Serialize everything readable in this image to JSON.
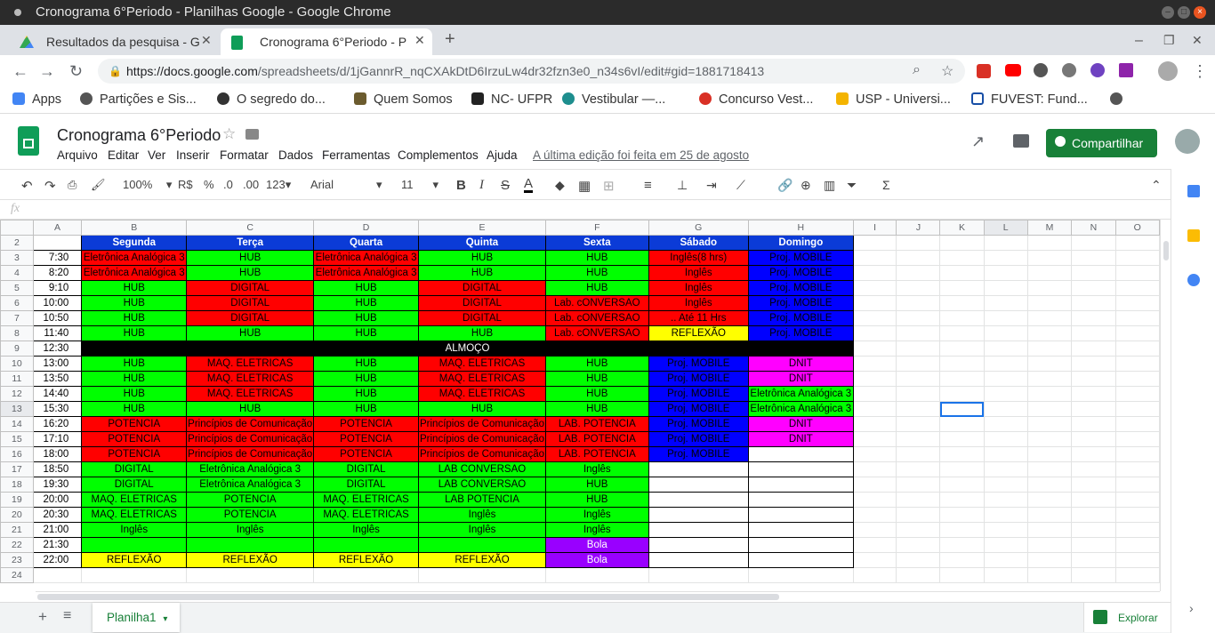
{
  "window": {
    "title": "Cronograma 6°Periodo - Planilhas Google - Google Chrome"
  },
  "tabs": [
    {
      "label": "Resultados da pesquisa - G"
    },
    {
      "label": "Cronograma 6°Periodo - P"
    }
  ],
  "address": {
    "host": "https://docs.google.com",
    "path": "/spreadsheets/d/1jGannrR_nqCXAkDtD6IrzuLw4dr32fzn3e0_n34s6vI/edit#gid=1881718413"
  },
  "bookmarks": [
    {
      "label": "Apps",
      "color": "#4285f4"
    },
    {
      "label": "Partições e Sis...",
      "color": "#555555"
    },
    {
      "label": "O segredo do...",
      "color": "#333333"
    },
    {
      "label": "Quem Somos",
      "color": "#6b5b2e"
    },
    {
      "label": "NC- UFPR",
      "color": "#222222"
    },
    {
      "label": "Vestibular —...",
      "color": "#1e8e8e"
    },
    {
      "label": "Concurso Vest...",
      "color": "#d93025"
    },
    {
      "label": "USP - Universi...",
      "color": "#f4b400"
    },
    {
      "label": "FUVEST: Fund...",
      "color": "#174ea6"
    }
  ],
  "doc": {
    "title": "Cronograma 6°Periodo",
    "menus": [
      "Arquivo",
      "Editar",
      "Ver",
      "Inserir",
      "Formatar",
      "Dados",
      "Ferramentas",
      "Complementos",
      "Ajuda"
    ],
    "last_edit": "A última edição foi feita em 25 de agosto",
    "share": "Compartilhar"
  },
  "toolbar": {
    "zoom": "100%",
    "currency": "R$",
    "percent": "%",
    "dec_less": ".0",
    "dec_more": ".00",
    "format": "123",
    "font": "Arial",
    "size": "11"
  },
  "formula": {
    "fx": "fx"
  },
  "sheet": {
    "columns": [
      "A",
      "B",
      "C",
      "D",
      "E",
      "F",
      "G",
      "H",
      "I",
      "J",
      "K",
      "L",
      "M",
      "N",
      "O"
    ],
    "rows": [
      [
        "",
        "Segunda",
        "Terça",
        "Quarta",
        "Quinta",
        "Sexta",
        "Sábado",
        "Domingo"
      ],
      [
        "7:30",
        "Eletrônica Analógica 3",
        "HUB",
        "Eletrônica Analógica 3",
        "HUB",
        "HUB",
        "Inglês(8 hrs)",
        "Proj. MOBILE"
      ],
      [
        "8:20",
        "Eletrônica Analógica 3",
        "HUB",
        "Eletrônica Analógica 3",
        "HUB",
        "HUB",
        "Inglês",
        "Proj. MOBILE"
      ],
      [
        "9:10",
        "HUB",
        "DIGITAL",
        "HUB",
        "DIGITAL",
        "HUB",
        "Inglês",
        "Proj. MOBILE"
      ],
      [
        "10:00",
        "HUB",
        "DIGITAL",
        "HUB",
        "DIGITAL",
        "Lab. cONVERSAO",
        "Inglês",
        "Proj. MOBILE"
      ],
      [
        "10:50",
        "HUB",
        "DIGITAL",
        "HUB",
        "DIGITAL",
        "Lab. cONVERSAO",
        ".. Até 11 Hrs",
        "Proj. MOBILE"
      ],
      [
        "11:40",
        "HUB",
        "HUB",
        "HUB",
        "HUB",
        "Lab. cONVERSAO",
        "REFLEXÃO",
        "Proj. MOBILE"
      ],
      [
        "12:30",
        "ALMOÇO"
      ],
      [
        "13:00",
        "HUB",
        "MAQ. ELETRICAS",
        "HUB",
        "MAQ. ELETRICAS",
        "HUB",
        "Proj. MOBILE",
        "DNIT"
      ],
      [
        "13:50",
        "HUB",
        "MAQ. ELETRICAS",
        "HUB",
        "MAQ. ELETRICAS",
        "HUB",
        "Proj. MOBILE",
        "DNIT"
      ],
      [
        "14:40",
        "HUB",
        "MAQ. ELETRICAS",
        "HUB",
        "MAQ. ELETRICAS",
        "HUB",
        "Proj. MOBILE",
        "Eletrônica Analógica 3"
      ],
      [
        "15:30",
        "HUB",
        "HUB",
        "HUB",
        "HUB",
        "HUB",
        "Proj. MOBILE",
        "Eletrônica Analógica 3"
      ],
      [
        "16:20",
        "POTENCIA",
        "Princípios de Comunicação",
        "POTENCIA",
        "Princípios de Comunicação",
        "LAB. POTENCIA",
        "Proj. MOBILE",
        "DNIT"
      ],
      [
        "17:10",
        "POTENCIA",
        "Princípios de Comunicação",
        "POTENCIA",
        "Princípios de Comunicação",
        "LAB. POTENCIA",
        "Proj. MOBILE",
        "DNIT"
      ],
      [
        "18:00",
        "POTENCIA",
        "Princípios de Comunicação",
        "POTENCIA",
        "Princípios de Comunicação",
        "LAB. POTENCIA",
        "Proj. MOBILE",
        ""
      ],
      [
        "18:50",
        "DIGITAL",
        "Eletrônica Analógica 3",
        "DIGITAL",
        "LAB CONVERSAO",
        "Inglês",
        "",
        ""
      ],
      [
        "19:30",
        "DIGITAL",
        "Eletrônica Analógica 3",
        "DIGITAL",
        "LAB CONVERSAO",
        "HUB",
        "",
        ""
      ],
      [
        "20:00",
        "MAQ. ELETRICAS",
        "POTENCIA",
        "MAQ. ELETRICAS",
        "LAB POTENCIA",
        "HUB",
        "",
        ""
      ],
      [
        "20:30",
        "MAQ. ELETRICAS",
        "POTENCIA",
        "MAQ. ELETRICAS",
        "Inglês",
        "Inglês",
        "",
        ""
      ],
      [
        "21:00",
        "Inglês",
        "Inglês",
        "Inglês",
        "Inglês",
        "Inglês",
        "",
        ""
      ],
      [
        "21:30",
        "",
        "",
        "",
        "",
        "Bola",
        "",
        ""
      ],
      [
        "22:00",
        "REFLEXÃO",
        "REFLEXÃO",
        "REFLEXÃO",
        "REFLEXÃO",
        "Bola",
        "",
        ""
      ]
    ],
    "colors": [
      [
        "h",
        "h",
        "h",
        "h",
        "h",
        "h",
        "h"
      ],
      [
        "r",
        "g",
        "r",
        "g",
        "g",
        "r",
        "b"
      ],
      [
        "r",
        "g",
        "r",
        "g",
        "g",
        "r",
        "b"
      ],
      [
        "g",
        "r",
        "g",
        "r",
        "g",
        "r",
        "b"
      ],
      [
        "g",
        "r",
        "g",
        "r",
        "r",
        "r",
        "b"
      ],
      [
        "g",
        "r",
        "g",
        "r",
        "r",
        "r",
        "b"
      ],
      [
        "g",
        "g",
        "g",
        "g",
        "r",
        "y",
        "b"
      ],
      [
        "k"
      ],
      [
        "g",
        "r",
        "g",
        "r",
        "g",
        "b",
        "m"
      ],
      [
        "g",
        "r",
        "g",
        "r",
        "g",
        "b",
        "m"
      ],
      [
        "g",
        "r",
        "g",
        "r",
        "g",
        "b",
        "g"
      ],
      [
        "g",
        "g",
        "g",
        "g",
        "g",
        "b",
        "g"
      ],
      [
        "r",
        "r",
        "r",
        "r",
        "r",
        "b",
        "m"
      ],
      [
        "r",
        "r",
        "r",
        "r",
        "r",
        "b",
        "m"
      ],
      [
        "r",
        "r",
        "r",
        "r",
        "r",
        "b",
        "w"
      ],
      [
        "g",
        "g",
        "g",
        "g",
        "g",
        "w",
        "w"
      ],
      [
        "g",
        "g",
        "g",
        "g",
        "g",
        "w",
        "w"
      ],
      [
        "g",
        "g",
        "g",
        "g",
        "g",
        "w",
        "w"
      ],
      [
        "g",
        "g",
        "g",
        "g",
        "g",
        "w",
        "w"
      ],
      [
        "g",
        "g",
        "g",
        "g",
        "g",
        "w",
        "w"
      ],
      [
        "g",
        "g",
        "g",
        "g",
        "p",
        "w",
        "w"
      ],
      [
        "y",
        "y",
        "y",
        "y",
        "p",
        "w",
        "w"
      ]
    ],
    "first_row_number": 2,
    "last_row_number": 24
  },
  "sheet_tab": {
    "label": "Planilha1"
  },
  "explore": {
    "label": "Explorar"
  }
}
